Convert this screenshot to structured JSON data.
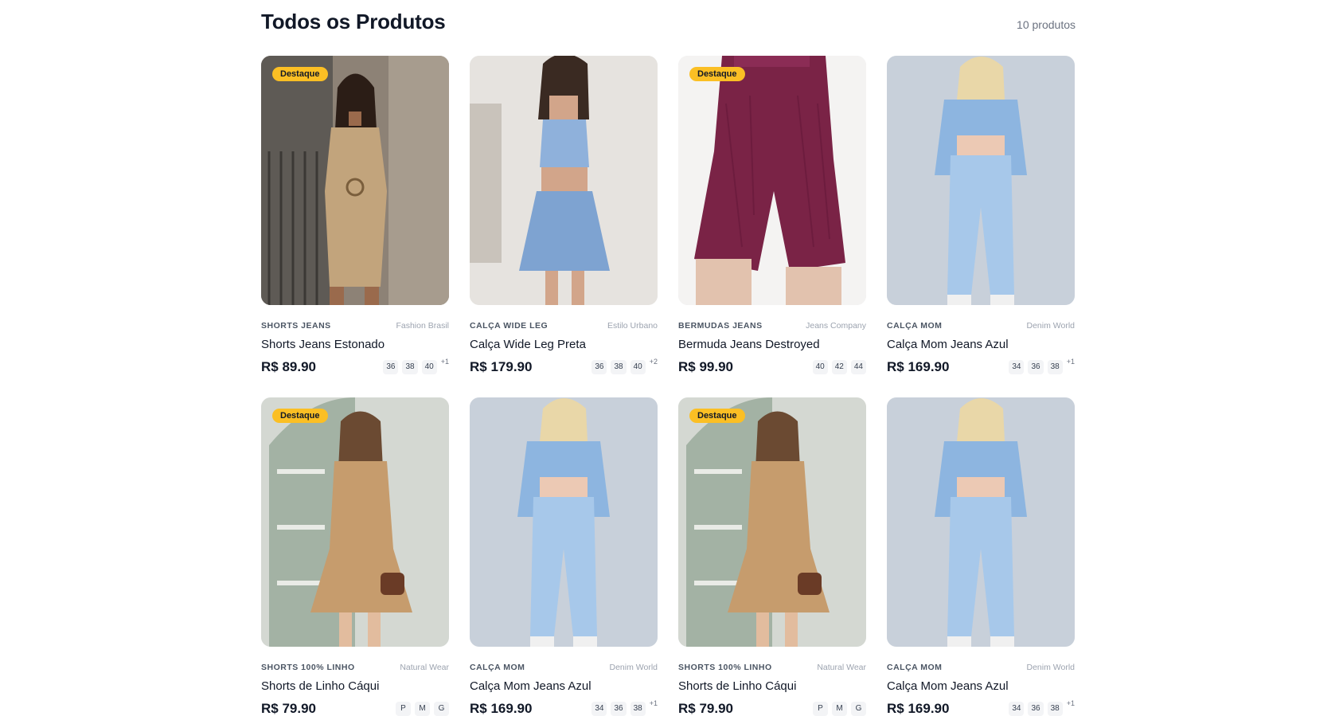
{
  "header": {
    "title": "Todos os Produtos",
    "count": "10 produtos"
  },
  "colors": {
    "badge": "#fbbf24",
    "text": "#111827",
    "muted": "#9ca3af"
  },
  "products": [
    {
      "badge": "Destaque",
      "category": "SHORTS JEANS",
      "brand": "Fashion Brasil",
      "name": "Shorts Jeans Estonado",
      "price": "R$ 89.90",
      "sizes": [
        "36",
        "38",
        "40"
      ],
      "more": "+1",
      "image": "beige-dress"
    },
    {
      "badge": "",
      "category": "CALÇA WIDE LEG",
      "brand": "Estilo Urbano",
      "name": "Calça Wide Leg Preta",
      "price": "R$ 179.90",
      "sizes": [
        "36",
        "38",
        "40"
      ],
      "more": "+2",
      "image": "blue-romper"
    },
    {
      "badge": "Destaque",
      "category": "BERMUDAS JEANS",
      "brand": "Jeans Company",
      "name": "Bermuda Jeans Destroyed",
      "price": "R$ 99.90",
      "sizes": [
        "40",
        "42",
        "44"
      ],
      "more": "",
      "image": "purple-shorts"
    },
    {
      "badge": "",
      "category": "CALÇA MOM",
      "brand": "Denim World",
      "name": "Calça Mom Jeans Azul",
      "price": "R$ 169.90",
      "sizes": [
        "34",
        "36",
        "38"
      ],
      "more": "+1",
      "image": "denim-outfit"
    },
    {
      "badge": "Destaque",
      "category": "SHORTS 100% LINHO",
      "brand": "Natural Wear",
      "name": "Shorts de Linho Cáqui",
      "price": "R$ 79.90",
      "sizes": [
        "P",
        "M",
        "G"
      ],
      "more": "",
      "image": "khaki-dress"
    },
    {
      "badge": "",
      "category": "CALÇA MOM",
      "brand": "Denim World",
      "name": "Calça Mom Jeans Azul",
      "price": "R$ 169.90",
      "sizes": [
        "34",
        "36",
        "38"
      ],
      "more": "+1",
      "image": "denim-outfit"
    },
    {
      "badge": "Destaque",
      "category": "SHORTS 100% LINHO",
      "brand": "Natural Wear",
      "name": "Shorts de Linho Cáqui",
      "price": "R$ 79.90",
      "sizes": [
        "P",
        "M",
        "G"
      ],
      "more": "",
      "image": "khaki-dress"
    },
    {
      "badge": "",
      "category": "CALÇA MOM",
      "brand": "Denim World",
      "name": "Calça Mom Jeans Azul",
      "price": "R$ 169.90",
      "sizes": [
        "34",
        "36",
        "38"
      ],
      "more": "+1",
      "image": "denim-outfit"
    }
  ]
}
